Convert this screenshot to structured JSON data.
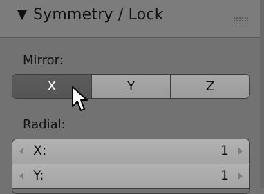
{
  "panel": {
    "title": "Symmetry / Lock",
    "icons": {
      "collapse": "triangle-down-icon",
      "drag": "grip-dots-icon"
    }
  },
  "mirror": {
    "label": "Mirror:",
    "options": [
      "X",
      "Y",
      "Z"
    ],
    "active": "X"
  },
  "radial": {
    "label": "Radial:",
    "fields": [
      {
        "label": "X:",
        "value": "1"
      },
      {
        "label": "Y:",
        "value": "1"
      }
    ]
  },
  "colors": {
    "panel_bg": "#727272",
    "button_bg": "#a4a4a4",
    "button_active": "#585858"
  }
}
